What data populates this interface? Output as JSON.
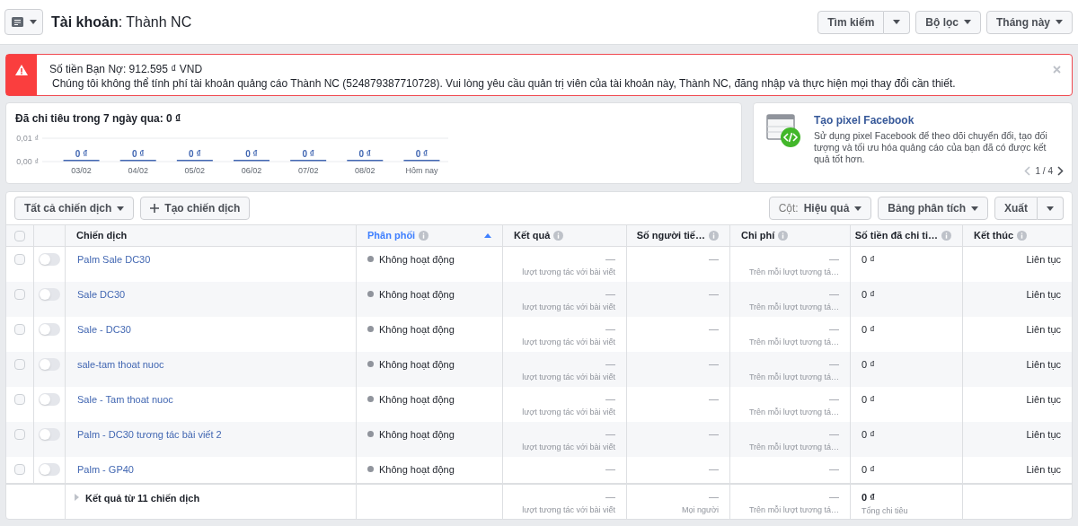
{
  "header": {
    "title": "**Tài khoản**: Thành NC",
    "buttons": [
      {
        "label": "Tìm kiếm",
        "kind": "split"
      },
      {
        "label": "Bộ lọc",
        "kind": "dropdown"
      },
      {
        "label": "Tháng này",
        "kind": "dropdown"
      }
    ]
  },
  "alert": {
    "title": "Số tiền Bạn Nợ: 912.595 ₫ VND",
    "message": "Chúng tôi không thể tính phí tài khoản quảng cáo Thành NC (524879387710728). Vui lòng yêu cầu quản trị viên của tài khoản này, Thành NC, đăng nhập và thực hiện mọi thay đổi cần thiết."
  },
  "spend": {
    "title": "Đã chi tiêu trong 7 ngày qua: 0 ₫",
    "chart_data": {
      "type": "bar",
      "categories": [
        "03/02",
        "04/02",
        "05/02",
        "06/02",
        "07/02",
        "08/02",
        "Hôm nay"
      ],
      "values": [
        0,
        0,
        0,
        0,
        0,
        0,
        0
      ],
      "ylim": [
        0,
        0.01
      ],
      "yticks": [
        {
          "value": 0,
          "label": "0,00 ₫"
        },
        {
          "value": 0.01,
          "label": "0,01 ₫"
        }
      ],
      "value_labels": [
        "0 ₫",
        "0 ₫",
        "0 ₫",
        "0 ₫",
        "0 ₫",
        "0 ₫",
        "0 ₫"
      ]
    }
  },
  "promo": {
    "title": "Tạo pixel Facebook",
    "text": "Sử dụng pixel Facebook để theo dõi chuyển đổi, tạo đối tượng và tối ưu hóa quảng cáo của bạn đã có được kết quả tốt hơn.",
    "pager": "1 / 4"
  },
  "toolbar": {
    "left": [
      {
        "label": "Tất cả chiến dịch",
        "kind": "dropdown"
      },
      {
        "label": "Tạo chiến dịch",
        "kind": "add"
      }
    ],
    "right": [
      {
        "prefix": "Cột:",
        "label": "Hiệu quả",
        "kind": "dropdown"
      },
      {
        "label": "Bảng phân tích",
        "kind": "dropdown"
      },
      {
        "label": "Xuất",
        "kind": "split"
      }
    ]
  },
  "table": {
    "header_checked": false,
    "columns": [
      {
        "label": "Chiến dịch",
        "sorted": false,
        "info": false
      },
      {
        "label": "Phân phối",
        "sorted": true,
        "info": true
      },
      {
        "label": "Kết quả",
        "sorted": false,
        "info": true
      },
      {
        "label": "Số người tiế…",
        "sorted": false,
        "info": true
      },
      {
        "label": "Chi phí",
        "sorted": false,
        "info": true
      },
      {
        "label": "Số tiền đã chi ti…",
        "sorted": false,
        "info": true
      },
      {
        "label": "Kết thúc",
        "sorted": false,
        "info": true
      }
    ],
    "rows": [
      {
        "checked": false,
        "on": false,
        "name": "Palm Sale DC30",
        "status": "Không hoạt động",
        "result": "—",
        "result_sub": "lượt tương tác với bài viết",
        "reach": "—",
        "cost": "—",
        "cost_sub": "Trên mỗi lượt tương tá…",
        "spent": "0 ₫",
        "end": "Liên tục"
      },
      {
        "checked": false,
        "on": false,
        "name": "Sale DC30",
        "status": "Không hoạt động",
        "result": "—",
        "result_sub": "lượt tương tác với bài viết",
        "reach": "—",
        "cost": "—",
        "cost_sub": "Trên mỗi lượt tương tá…",
        "spent": "0 ₫",
        "end": "Liên tục"
      },
      {
        "checked": false,
        "on": false,
        "name": "Sale - DC30",
        "status": "Không hoạt động",
        "result": "—",
        "result_sub": "lượt tương tác với bài viết",
        "reach": "—",
        "cost": "—",
        "cost_sub": "Trên mỗi lượt tương tá…",
        "spent": "0 ₫",
        "end": "Liên tục"
      },
      {
        "checked": false,
        "on": false,
        "name": "sale-tam thoat nuoc",
        "status": "Không hoạt động",
        "result": "—",
        "result_sub": "lượt tương tác với bài viết",
        "reach": "—",
        "cost": "—",
        "cost_sub": "Trên mỗi lượt tương tá…",
        "spent": "0 ₫",
        "end": "Liên tục"
      },
      {
        "checked": false,
        "on": false,
        "name": "Sale - Tam thoat nuoc",
        "status": "Không hoạt động",
        "result": "—",
        "result_sub": "lượt tương tác với bài viết",
        "reach": "—",
        "cost": "—",
        "cost_sub": "Trên mỗi lượt tương tá…",
        "spent": "0 ₫",
        "end": "Liên tục"
      },
      {
        "checked": false,
        "on": false,
        "name": "Palm - DC30 tương tác bài viết 2",
        "status": "Không hoạt động",
        "result": "—",
        "result_sub": "lượt tương tác với bài viết",
        "reach": "—",
        "cost": "—",
        "cost_sub": "Trên mỗi lượt tương tá…",
        "spent": "0 ₫",
        "end": "Liên tục"
      },
      {
        "checked": false,
        "on": false,
        "name": "Palm - GP40",
        "status": "Không hoạt động",
        "result": "—",
        "reach": "—",
        "cost": "—",
        "spent": "0 ₫",
        "end": "Liên tục"
      }
    ],
    "footer": {
      "label": "Kết quả từ 11 chiến dịch",
      "result": "—",
      "result_sub": "lượt tương tác với bài viết",
      "reach": "—",
      "reach_sub": "Mọi người",
      "cost": "—",
      "cost_sub": "Trên mỗi lượt tương tá…",
      "spent": "0 ₫",
      "spent_sub": "Tổng chi tiêu"
    }
  }
}
